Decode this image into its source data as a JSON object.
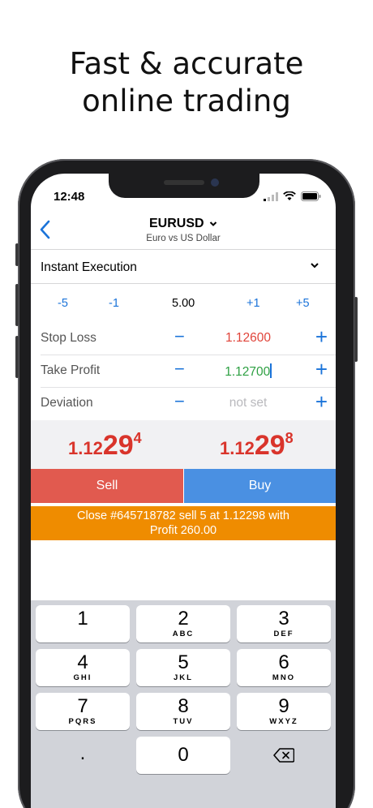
{
  "headline": {
    "line1": "Fast & accurate",
    "line2": "online trading"
  },
  "status_bar": {
    "time": "12:48"
  },
  "nav": {
    "symbol": "EURUSD",
    "description": "Euro vs US Dollar"
  },
  "execution": {
    "mode": "Instant Execution"
  },
  "volume": {
    "minus5": "-5",
    "minus1": "-1",
    "value": "5.00",
    "plus1": "+1",
    "plus5": "+5"
  },
  "params": [
    {
      "label": "Stop Loss",
      "value": "1.12600",
      "color": "#e0443a"
    },
    {
      "label": "Take Profit",
      "value": "1.12700",
      "color": "#2ea043"
    },
    {
      "label": "Deviation",
      "value": "not set",
      "color": "#b9b9bd"
    }
  ],
  "prices": {
    "sell": {
      "small": "1.12",
      "big": "29",
      "sup": "4"
    },
    "buy": {
      "small": "1.12",
      "big": "29",
      "sup": "8"
    }
  },
  "buttons": {
    "sell": "Sell",
    "buy": "Buy"
  },
  "banner": {
    "line1": "Close #645718782 sell 5 at 1.12298 with",
    "line2": "Profit 260.00"
  },
  "keypad": [
    {
      "num": "1",
      "letters": ""
    },
    {
      "num": "2",
      "letters": "ABC"
    },
    {
      "num": "3",
      "letters": "DEF"
    },
    {
      "num": "4",
      "letters": "GHI"
    },
    {
      "num": "5",
      "letters": "JKL"
    },
    {
      "num": "6",
      "letters": "MNO"
    },
    {
      "num": "7",
      "letters": "PQRS"
    },
    {
      "num": "8",
      "letters": "TUV"
    },
    {
      "num": "9",
      "letters": "WXYZ"
    },
    {
      "num": ".",
      "letters": ""
    },
    {
      "num": "0",
      "letters": ""
    }
  ],
  "colors": {
    "accent_blue": "#1a73d9",
    "sell": "#e15a4f",
    "buy": "#4a90e2",
    "banner": "#ef8c00",
    "price": "#d9342b"
  },
  "icons": [
    "back-chevron-icon",
    "dropdown-chevron-icon",
    "signal-icon",
    "wifi-icon",
    "battery-icon",
    "backspace-icon"
  ]
}
